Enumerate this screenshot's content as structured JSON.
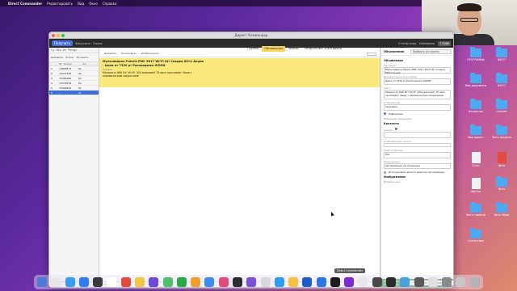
{
  "menubar": {
    "app_name": "Direct Commander",
    "items": [
      "Редактировать",
      "Вид",
      "Окно",
      "Справка"
    ]
  },
  "window": {
    "title": "Директ Коммандер"
  },
  "toolbar": {
    "get_button": "Получить",
    "items": [
      "Загрузить",
      "Поиск",
      "Статистика",
      "Кампании"
    ],
    "balance": "7 008₽"
  },
  "left_panel": {
    "tabs": [
      "Гр",
      "Объ",
      "Кл",
      "Ретарг"
    ],
    "tools": [
      "Добавить",
      "Копир.",
      "Вставить"
    ],
    "columns": [
      "",
      "ID",
      "Номер",
      "Фр"
    ],
    "rows": [
      {
        "a": "1",
        "b": "74828575",
        "c": "Ре"
      },
      {
        "a": "2",
        "b": "73071383",
        "c": "Ре"
      },
      {
        "a": "3",
        "b": "72404280",
        "c": "Ре"
      },
      {
        "a": "4",
        "b": "74745878",
        "c": "Ре"
      },
      {
        "a": "5",
        "b": "74426610",
        "c": "Ре"
      },
      {
        "a": "6",
        "b": "---",
        "c": "Ре"
      }
    ],
    "footer": "Найти"
  },
  "center_panel": {
    "top_tabs": [
      "Группы",
      "Объявления",
      "Фразы",
      "Ретаргетинг и интересы"
    ],
    "tools": [
      "Добавить",
      "Копировать",
      "Изображения"
    ],
    "ad": {
      "title": "Мультиварка Polaris PMC 5017 Wi-Fi IQ! Скидка 60%! Акция",
      "subtitle": "- Цена от 7320 р! Распродажа GIZON",
      "label": "Ссылка",
      "desc_line1": "Мощность 860 Вт! Wi-Fi! 300 режимов! 70 авто программ! Чаша с",
      "desc_line2": "керамическим покрытием!"
    },
    "footer": "Найти"
  },
  "right_panel": {
    "header": "Объявление",
    "group_select": "Выбрать из группы",
    "section1": "Объявление",
    "title_label": "Заголовок",
    "title_value": "Мультиварка Polaris PMC 5017 Wi-Fi IQ! Скидка 60%! Акция",
    "extra_label": "Дополнительный заголовок",
    "extra_value": "Цена от 7320 р! Распродажа GIZON",
    "text_label": "Текст",
    "text_value": "Мощность 860 Вт! Wi-Fi! 300 режимов! 70 авто программ! Чаша с керамическим покрытием!",
    "display_label": "Отображение",
    "display_value": "Черновик",
    "mobile_label": "Мобильное",
    "mobile_sub": "Мобильное объявление",
    "section2": "Контакты",
    "link_label": "Ссылка",
    "link_value": "",
    "display_link_label": "Отображаемая ссылка",
    "turbo_label": "Турбо-страница",
    "turbo_value": "Нет",
    "org_label": "Организация",
    "org_value": "Организация не привязана",
    "org_check": "Использовать вместо визитки организации",
    "section3": "Изображение",
    "image_label": "Изображение",
    "foot_label": "Изменения сохранены",
    "foot_btn1": "Отменить",
    "foot_btn2": "Сохранить"
  },
  "desktop_icons": [
    {
      "label": "ПРОГРАММЫ",
      "kind": "folder"
    },
    {
      "label": "ФОТО",
      "kind": "folder"
    },
    {
      "label": "Мои документы",
      "kind": "folder"
    },
    {
      "label": "ФОТО",
      "kind": "folder"
    },
    {
      "label": "Коллектор",
      "kind": "folder"
    },
    {
      "label": "Linkedln",
      "kind": "folder"
    },
    {
      "label": "Мои директ",
      "kind": "folder"
    },
    {
      "label": "Фото раздела",
      "kind": "folder"
    },
    {
      "label": "Отчет",
      "kind": "doc"
    },
    {
      "label": "Фото",
      "kind": "pdf"
    },
    {
      "label": "Аватар",
      "kind": "doc"
    },
    {
      "label": "Фото",
      "kind": "folder"
    },
    {
      "label": "Фото главный",
      "kind": "folder"
    },
    {
      "label": "Фото Ящик",
      "kind": "folder"
    },
    {
      "label": "Статистика",
      "kind": "folder"
    }
  ],
  "dock": {
    "tooltip": "Direct Commander",
    "icon_colors": [
      "#4a7bd8",
      "#e7e7e7",
      "#3a9df4",
      "#2f7ef0",
      "#3a3a3a",
      "#ffffff",
      "#e24c3c",
      "#f5c542",
      "#6a4ad6",
      "#4fbf6b",
      "#2ba84a",
      "#f0a030",
      "#3a8ef0",
      "#e34b7a",
      "#2d2d2d",
      "#7b51d6",
      "#d9d9d9",
      "#2f9cf0",
      "#f6c23e",
      "#1e5cc8",
      "#2c78e0",
      "#1d1d1d",
      "#7a2bd1",
      "#e8e8e8",
      "#4a4a4a",
      "#2a2a2a",
      "#46a3e0",
      "#5a5a5a",
      "#e0e0e0",
      "#8a8a8a",
      "#c7c7c7",
      "#b3b3b3"
    ]
  }
}
